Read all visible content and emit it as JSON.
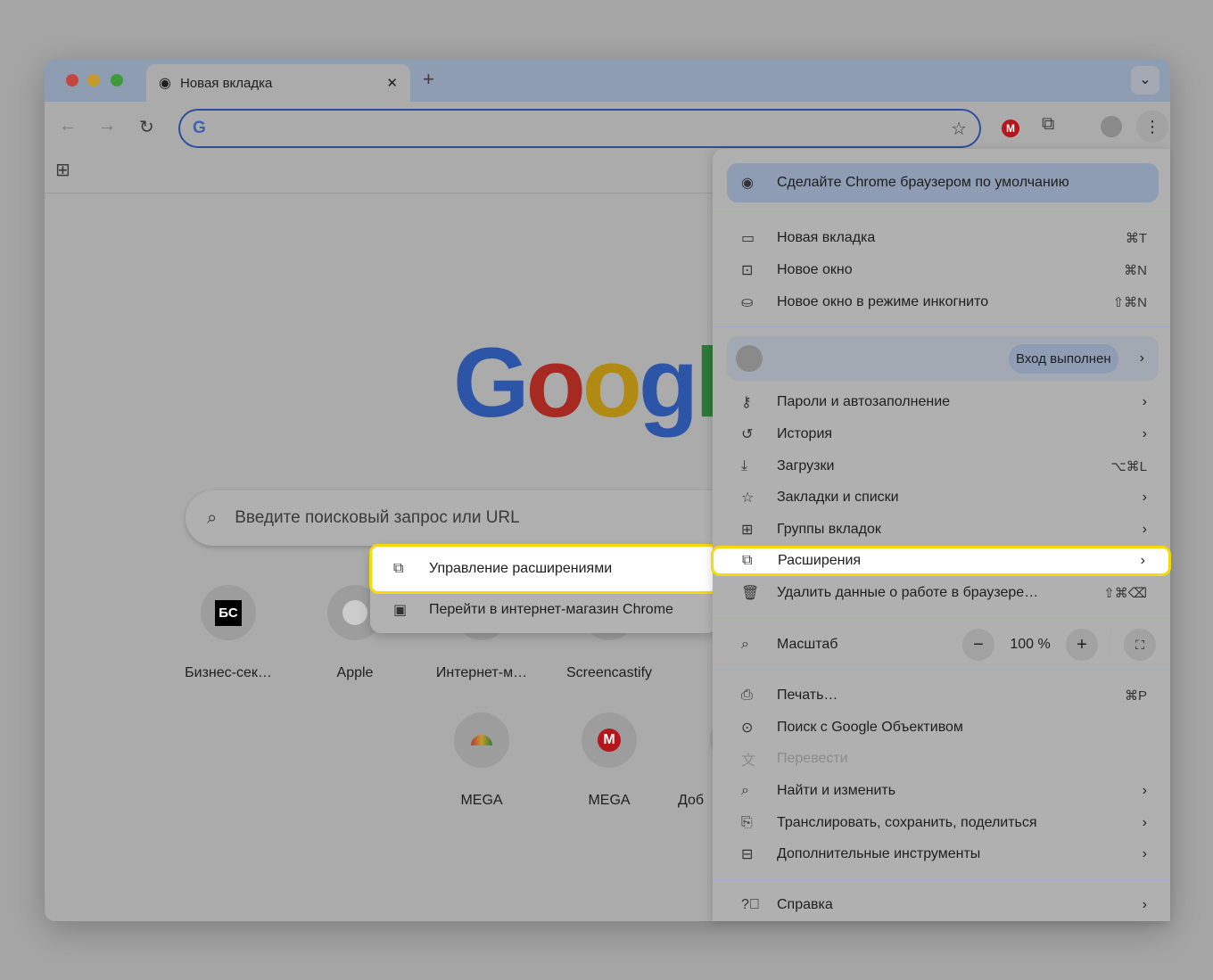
{
  "tab": {
    "title": "Новая вкладка"
  },
  "toolbar": {
    "address_value": ""
  },
  "google_logo": "Goog",
  "search": {
    "placeholder": "Введите поисковый запрос или URL"
  },
  "shortcuts": [
    {
      "label": "Бизнес-сек…",
      "icon_text": "БС"
    },
    {
      "label": "Apple",
      "icon_text": ""
    },
    {
      "label": "Интернет-м…"
    },
    {
      "label": "Screencastify"
    },
    {
      "label": "MEGA"
    },
    {
      "label": "MEGA",
      "icon_text": "M"
    },
    {
      "label": "Доб"
    }
  ],
  "submenu": {
    "items": [
      {
        "label": "Управление расширениями"
      },
      {
        "label": "Перейти в интернет-магазин Chrome"
      }
    ]
  },
  "menu": {
    "default_banner": "Сделайте Chrome браузером по умолчанию",
    "new_tab": {
      "label": "Новая вкладка",
      "key": "⌘T"
    },
    "new_window": {
      "label": "Новое окно",
      "key": "⌘N"
    },
    "incognito": {
      "label": "Новое окно в режиме инкогнито",
      "key": "⇧⌘N"
    },
    "profile_status": "Вход выполнен",
    "passwords": "Пароли и автозаполнение",
    "history": "История",
    "downloads": {
      "label": "Загрузки",
      "key": "⌥⌘L"
    },
    "bookmarks": "Закладки и списки",
    "tab_groups": "Группы вкладок",
    "extensions": "Расширения",
    "clear_data": {
      "label": "Удалить данные о работе в браузере…",
      "key": "⇧⌘⌫"
    },
    "zoom": {
      "label": "Масштаб",
      "value": "100 %",
      "minus": "−",
      "plus": "+"
    },
    "print": {
      "label": "Печать…",
      "key": "⌘P"
    },
    "lens": "Поиск с Google Объективом",
    "translate": "Перевести",
    "find": "Найти и изменить",
    "cast": "Транслировать, сохранить, поделиться",
    "more_tools": "Дополнительные инструменты",
    "help": "Справка"
  }
}
